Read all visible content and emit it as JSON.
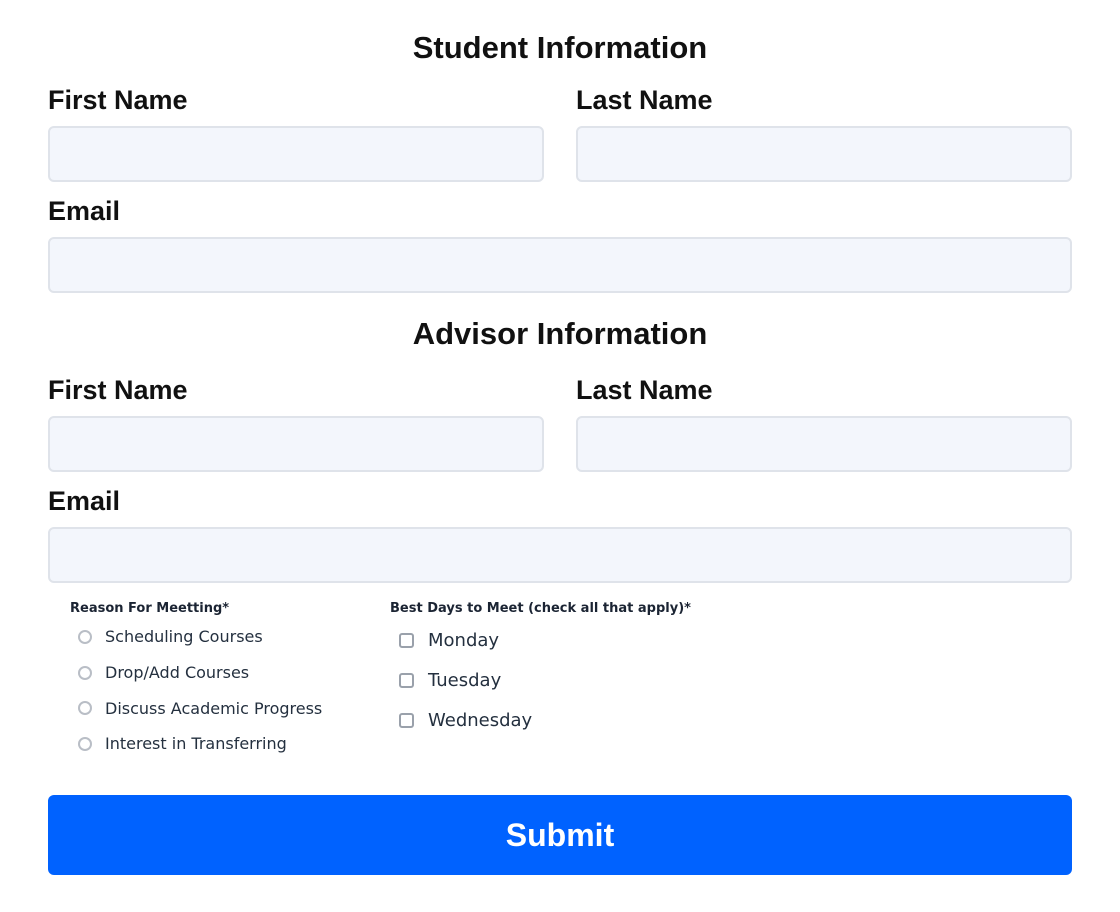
{
  "student": {
    "title": "Student Information",
    "first_name_label": "First Name",
    "first_name_value": "",
    "last_name_label": "Last Name",
    "last_name_value": "",
    "email_label": "Email",
    "email_value": ""
  },
  "advisor": {
    "title": "Advisor Information",
    "first_name_label": "First Name",
    "first_name_value": "",
    "last_name_label": "Last Name",
    "last_name_value": "",
    "email_label": "Email",
    "email_value": ""
  },
  "reason": {
    "label": "Reason For Meetting*",
    "options": [
      {
        "label": "Scheduling Courses",
        "selected": false
      },
      {
        "label": "Drop/Add Courses",
        "selected": false
      },
      {
        "label": "Discuss Academic Progress",
        "selected": false
      },
      {
        "label": "Interest in Transferring",
        "selected": false
      }
    ]
  },
  "days": {
    "label": "Best Days to Meet (check all that apply)*",
    "options": [
      {
        "label": "Monday",
        "checked": false
      },
      {
        "label": "Tuesday",
        "checked": false
      },
      {
        "label": "Wednesday",
        "checked": false
      }
    ]
  },
  "submit_label": "Submit",
  "colors": {
    "primary": "#0062ff",
    "input_background": "#f3f6fc",
    "input_border": "#dfe3ea",
    "text": "#111111"
  }
}
